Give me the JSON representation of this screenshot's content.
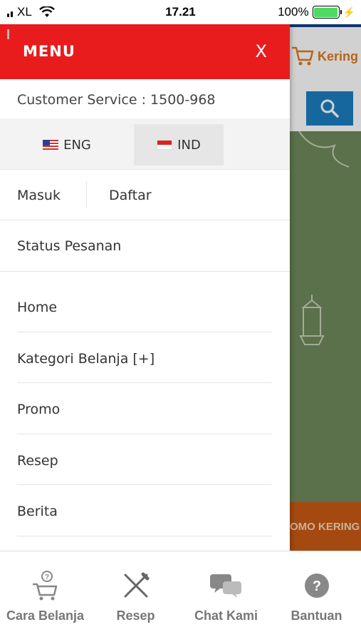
{
  "status_bar": {
    "carrier": "XL",
    "time": "17.21",
    "battery_percent": "100%",
    "battery_level": 1.0
  },
  "background": {
    "cart_label": "Kering",
    "promo_text": "OMO KERING",
    "colors": {
      "header_border": "#16408a",
      "search_button": "#1d7ec2",
      "banner": "#6e8a5c",
      "promo": "#c85a14"
    }
  },
  "drawer": {
    "title": "MENU",
    "close": "X",
    "customer_service": "Customer Service : 1500-968",
    "languages": [
      {
        "label": "ENG",
        "flag": "us-flag-icon"
      },
      {
        "label": "IND",
        "flag": "id-flag-icon"
      }
    ],
    "auth": {
      "login": "Masuk",
      "register": "Daftar"
    },
    "order_status": "Status Pesanan",
    "items": [
      {
        "label": "Home"
      },
      {
        "label": "Kategori Belanja [+]"
      },
      {
        "label": "Promo"
      },
      {
        "label": "Resep"
      },
      {
        "label": "Berita"
      }
    ],
    "colors": {
      "header": "#e81c1c"
    }
  },
  "tabbar": {
    "tabs": [
      {
        "label": "Cara Belanja",
        "icon": "cart-question-icon"
      },
      {
        "label": "Resep",
        "icon": "fork-knife-icon"
      },
      {
        "label": "Chat Kami",
        "icon": "chat-bubbles-icon"
      },
      {
        "label": "Bantuan",
        "icon": "help-circle-icon"
      }
    ]
  }
}
